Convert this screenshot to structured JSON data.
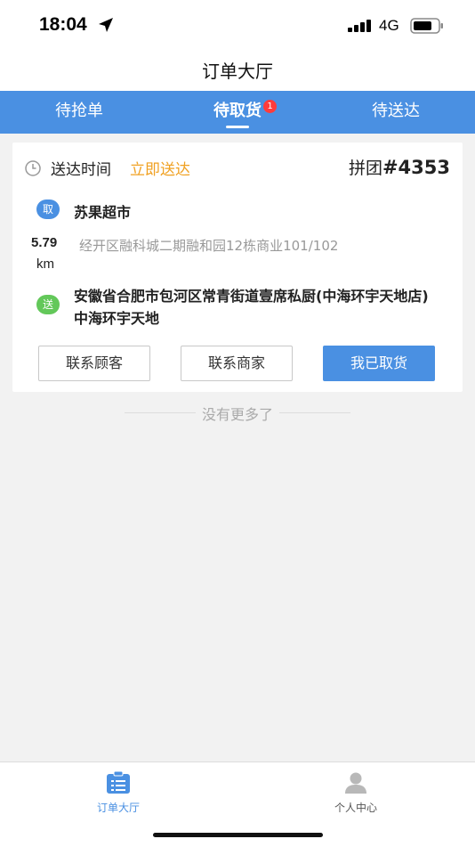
{
  "status_bar": {
    "time": "18:04",
    "network": "4G"
  },
  "nav": {
    "title": "订单大厅"
  },
  "tabs": [
    {
      "label": "待抢单"
    },
    {
      "label": "待取货",
      "badge": "1"
    },
    {
      "label": "待送达"
    }
  ],
  "order": {
    "delivery_time_label": "送达时间",
    "delivery_time_value": "立即送达",
    "group_prefix": "拼团",
    "group_number": "#4353",
    "pickup_tag": "取",
    "shop_name": "苏果超市",
    "distance_value": "5.79",
    "distance_unit": "km",
    "pickup_address": "经开区融科城二期融和园12栋商业101/102",
    "dropoff_tag": "送",
    "dropoff_address": "安徽省合肥市包河区常青街道壹席私厨(中海环宇天地店)中海环宇天地",
    "buttons": {
      "contact_customer": "联系顾客",
      "contact_merchant": "联系商家",
      "picked_up": "我已取货"
    }
  },
  "list_end_text": "没有更多了",
  "bottom_nav": [
    {
      "label": "订单大厅"
    },
    {
      "label": "个人中心"
    }
  ],
  "colors": {
    "accent": "#4a90e2",
    "warning": "#f0a122",
    "success": "#63c85a",
    "badge": "#ff3b3b"
  },
  "icons": {
    "clock": "clock-icon",
    "order_hall": "clipboard-list-icon",
    "profile": "person-icon"
  }
}
